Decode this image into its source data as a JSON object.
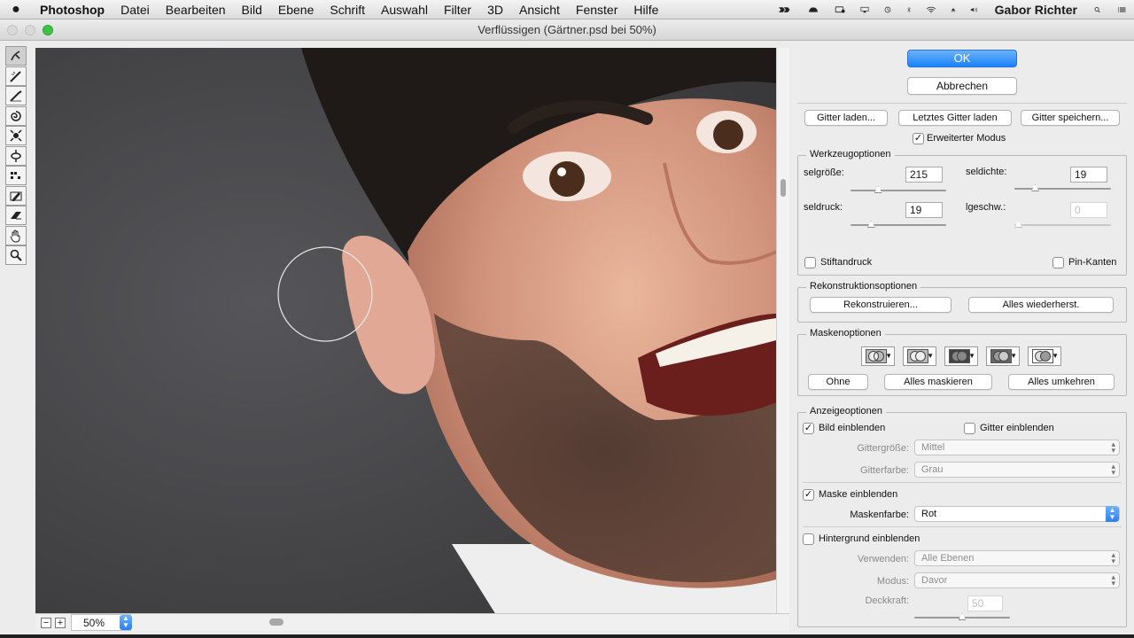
{
  "menubar": {
    "apple_icon": "apple-icon",
    "app_name": "Photoshop",
    "items": [
      "Datei",
      "Bearbeiten",
      "Bild",
      "Ebene",
      "Schrift",
      "Auswahl",
      "Filter",
      "3D",
      "Ansicht",
      "Fenster",
      "Hilfe"
    ],
    "user": "Gabor Richter"
  },
  "window": {
    "title": "Verflüssigen (Gärtner.psd bei 50%)"
  },
  "tools": [
    "forward-warp-tool",
    "reconstruct-tool",
    "smooth-tool",
    "twirl-clockwise-tool",
    "pucker-tool",
    "bloat-tool",
    "push-left-tool",
    "freeze-mask-tool",
    "thaw-mask-tool",
    "hand-tool",
    "zoom-tool"
  ],
  "statusbar": {
    "zoom": "50%",
    "minus": "−",
    "plus": "+"
  },
  "dialog": {
    "ok": "OK",
    "cancel": "Abbrechen",
    "mesh": {
      "load": "Gitter laden...",
      "load_last": "Letztes Gitter laden",
      "save": "Gitter speichern..."
    },
    "advanced_mode": "Erweiterter Modus",
    "tool_options": {
      "legend": "Werkzeugoptionen",
      "size_label": "selgröße:",
      "size_value": "215",
      "size_level": 0.27,
      "density_label": "seldichte:",
      "density_value": "19",
      "density_level": 0.19,
      "pressure_label": "seldruck:",
      "pressure_value": "19",
      "pressure_level": 0.19,
      "rate_label": "lgeschw.:",
      "rate_value": "0",
      "rate_level": 0.0,
      "stylus_pressure": "Stiftandruck",
      "pin_edges": "Pin-Kanten"
    },
    "reconstruct_options": {
      "legend": "Rekonstruktionsoptionen",
      "reconstruct": "Rekonstruieren...",
      "restore_all": "Alles wiederherst."
    },
    "mask_options": {
      "legend": "Maskenoptionen",
      "none": "Ohne",
      "mask_all": "Alles maskieren",
      "invert_all": "Alles umkehren"
    },
    "view_options": {
      "legend": "Anzeigeoptionen",
      "show_image": "Bild einblenden",
      "show_mesh": "Gitter einblenden",
      "mesh_size_label": "Gittergröße:",
      "mesh_size": "Mittel",
      "mesh_color_label": "Gitterfarbe:",
      "mesh_color": "Grau",
      "show_mask": "Maske einblenden",
      "mask_color_label": "Maskenfarbe:",
      "mask_color": "Rot",
      "show_backdrop": "Hintergrund einblenden",
      "use_label": "Verwenden:",
      "use": "Alle Ebenen",
      "mode_label": "Modus:",
      "mode": "Davor",
      "opacity_label": "Deckkraft:",
      "opacity": "50",
      "opacity_level": 0.5
    },
    "checkmark": "✓"
  },
  "colors": {
    "accent": "#1a82fb",
    "canvas_bg": "#48484a"
  }
}
